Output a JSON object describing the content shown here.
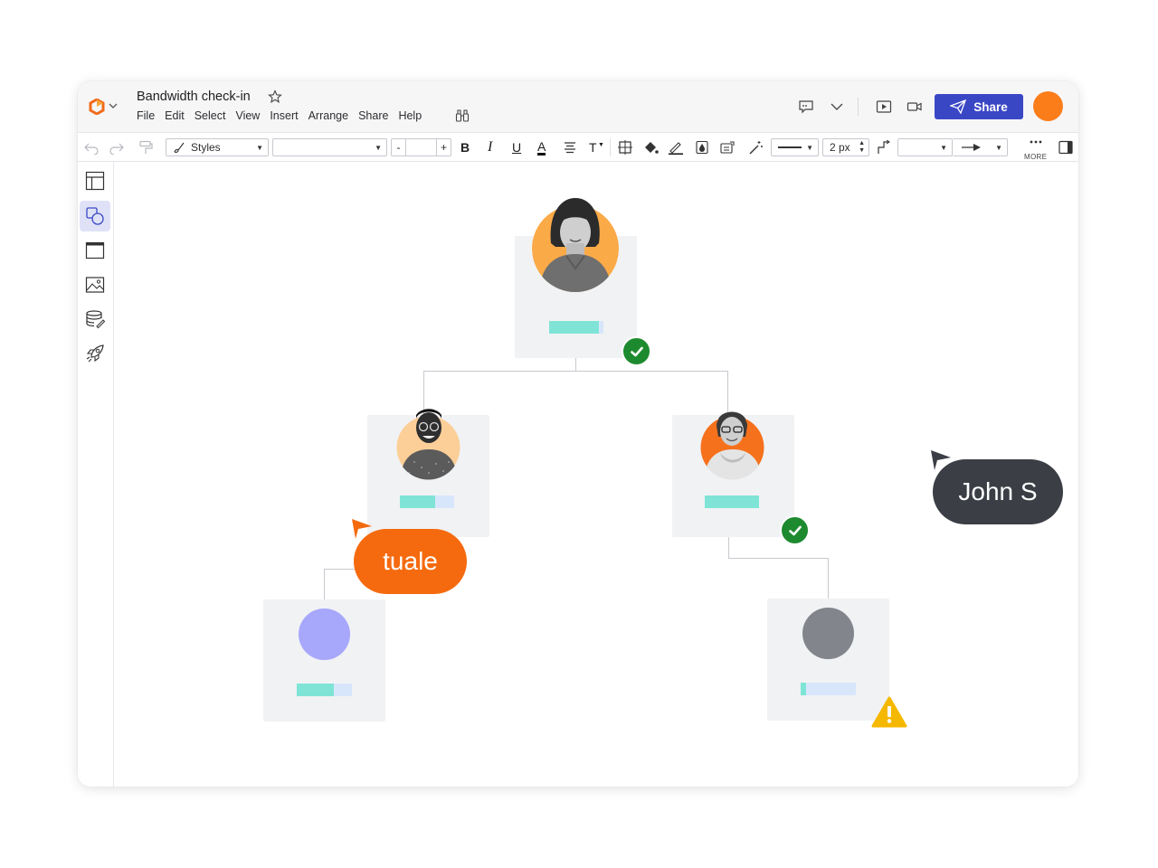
{
  "app": {
    "doc_title": "Bandwidth check-in",
    "menu": [
      "File",
      "Edit",
      "Select",
      "View",
      "Insert",
      "Arrange",
      "Share",
      "Help"
    ],
    "share_label": "Share"
  },
  "toolbar": {
    "styles_label": "Styles",
    "font_value": "",
    "size_value": "",
    "minus_label": "-",
    "plus_label": "+",
    "bold_label": "B",
    "italic_label": "I",
    "underline_label": "U",
    "font_color_label": "A",
    "text_size_label": "T",
    "line_width": "2 px",
    "more_label": "MORE"
  },
  "sidebar": {
    "items": [
      "page-layout-icon",
      "shapes-icon",
      "template-icon",
      "image-icon",
      "data-icon",
      "rocket-icon"
    ],
    "active_index": 1
  },
  "colors": {
    "brand": "#fb7d1a",
    "share_button": "#3a47c5",
    "check": "#1e8a2f",
    "warning": "#f5b800",
    "cursor_tuale": "#f56a0e",
    "cursor_john": "#3b3e45",
    "node_purple": "#a7a7fb",
    "node_gray": "#82858c"
  },
  "collaborators": [
    {
      "name": "tuale",
      "color": "#f56a0e"
    },
    {
      "name": "John S",
      "color": "#3b3e45"
    }
  ],
  "org_chart": {
    "root": {
      "status": "check",
      "progress": 0.92
    },
    "children": [
      {
        "id": "left",
        "status": "none",
        "progress": 0.65
      },
      {
        "id": "right",
        "status": "check",
        "progress": 1.0
      }
    ],
    "grandchildren": [
      {
        "id": "left-child",
        "status": "none",
        "progress": 0.68,
        "avatar": "purple"
      },
      {
        "id": "right-child",
        "status": "warning",
        "progress": 0.1,
        "avatar": "gray"
      }
    ]
  }
}
